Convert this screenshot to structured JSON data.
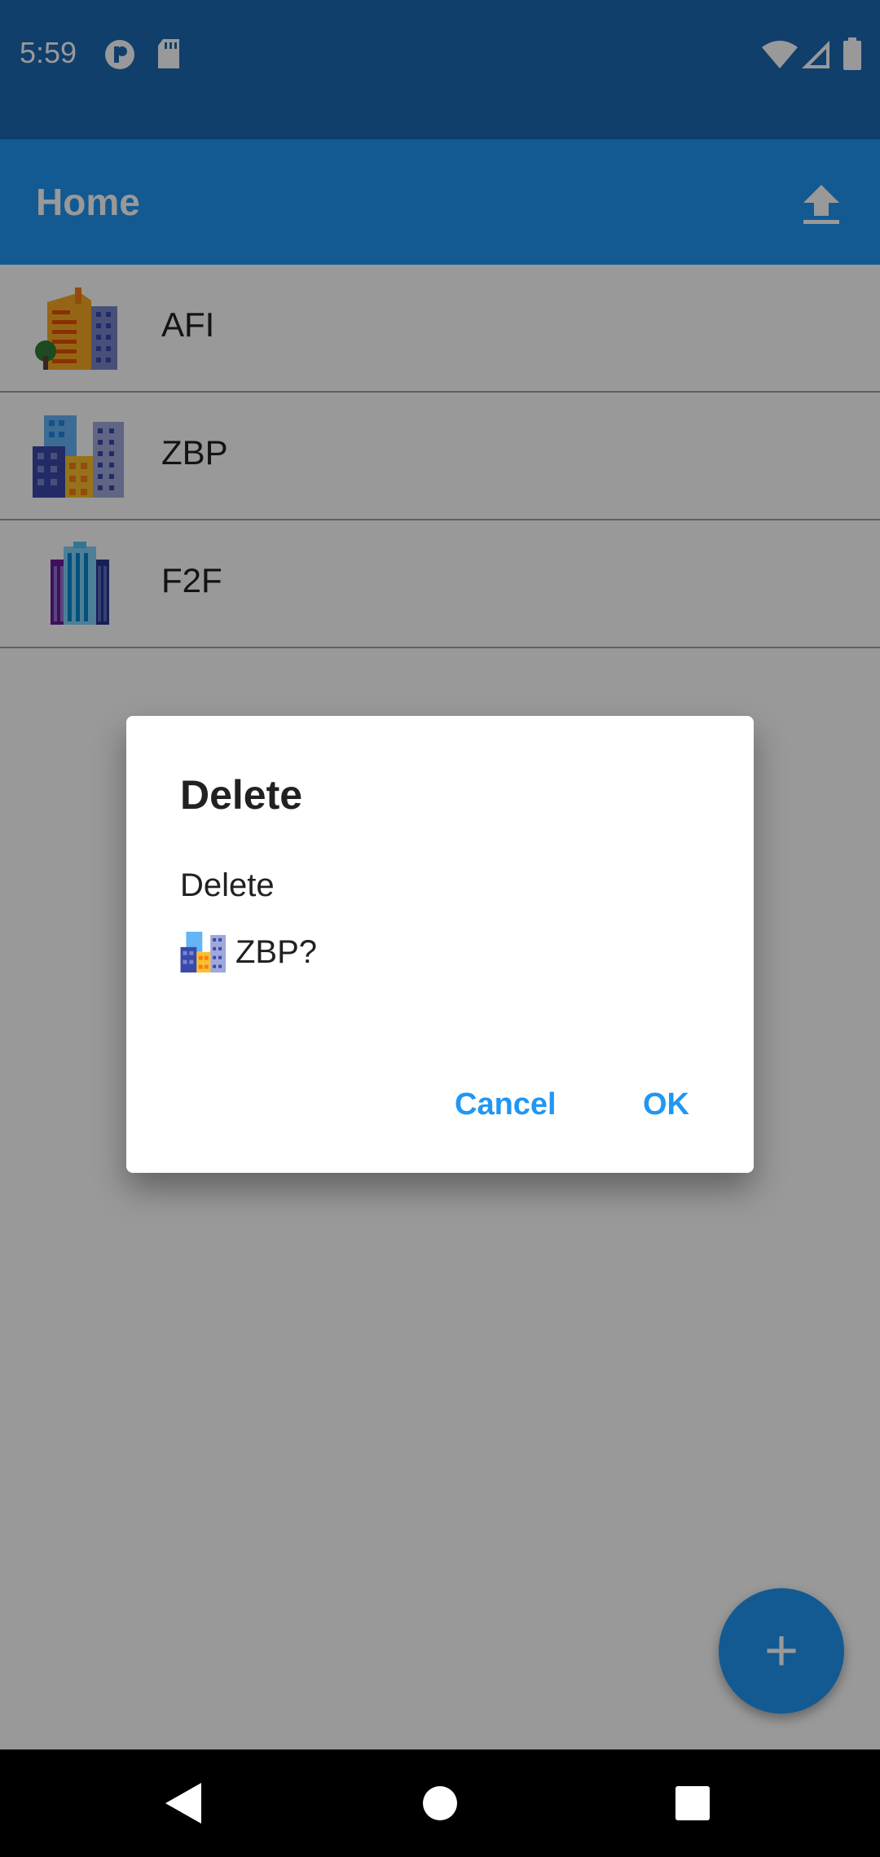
{
  "status_bar": {
    "time": "5:59",
    "left_icons": [
      "notification-app-icon",
      "sd-card-icon"
    ],
    "right_icons": [
      "wifi-icon",
      "signal-icon",
      "battery-icon"
    ]
  },
  "app_bar": {
    "title": "Home",
    "action_icon": "upload-icon"
  },
  "list": {
    "items": [
      {
        "label": "AFI",
        "icon": "orange-building-icon"
      },
      {
        "label": "ZBP",
        "icon": "city-buildings-icon"
      },
      {
        "label": "F2F",
        "icon": "skyscraper-icon"
      }
    ]
  },
  "dialog": {
    "title": "Delete",
    "message": "Delete",
    "item_label": "ZBP?",
    "item_icon": "city-buildings-icon",
    "cancel_label": "Cancel",
    "ok_label": "OK"
  },
  "fab": {
    "icon": "plus-icon",
    "label": "+"
  },
  "nav_bar": {
    "icons": [
      "back-icon",
      "home-icon",
      "recents-icon"
    ]
  },
  "colors": {
    "primary": "#2196f3",
    "primary_dark": "#1b69b4",
    "scrim": "rgba(0,0,0,0.4)"
  }
}
